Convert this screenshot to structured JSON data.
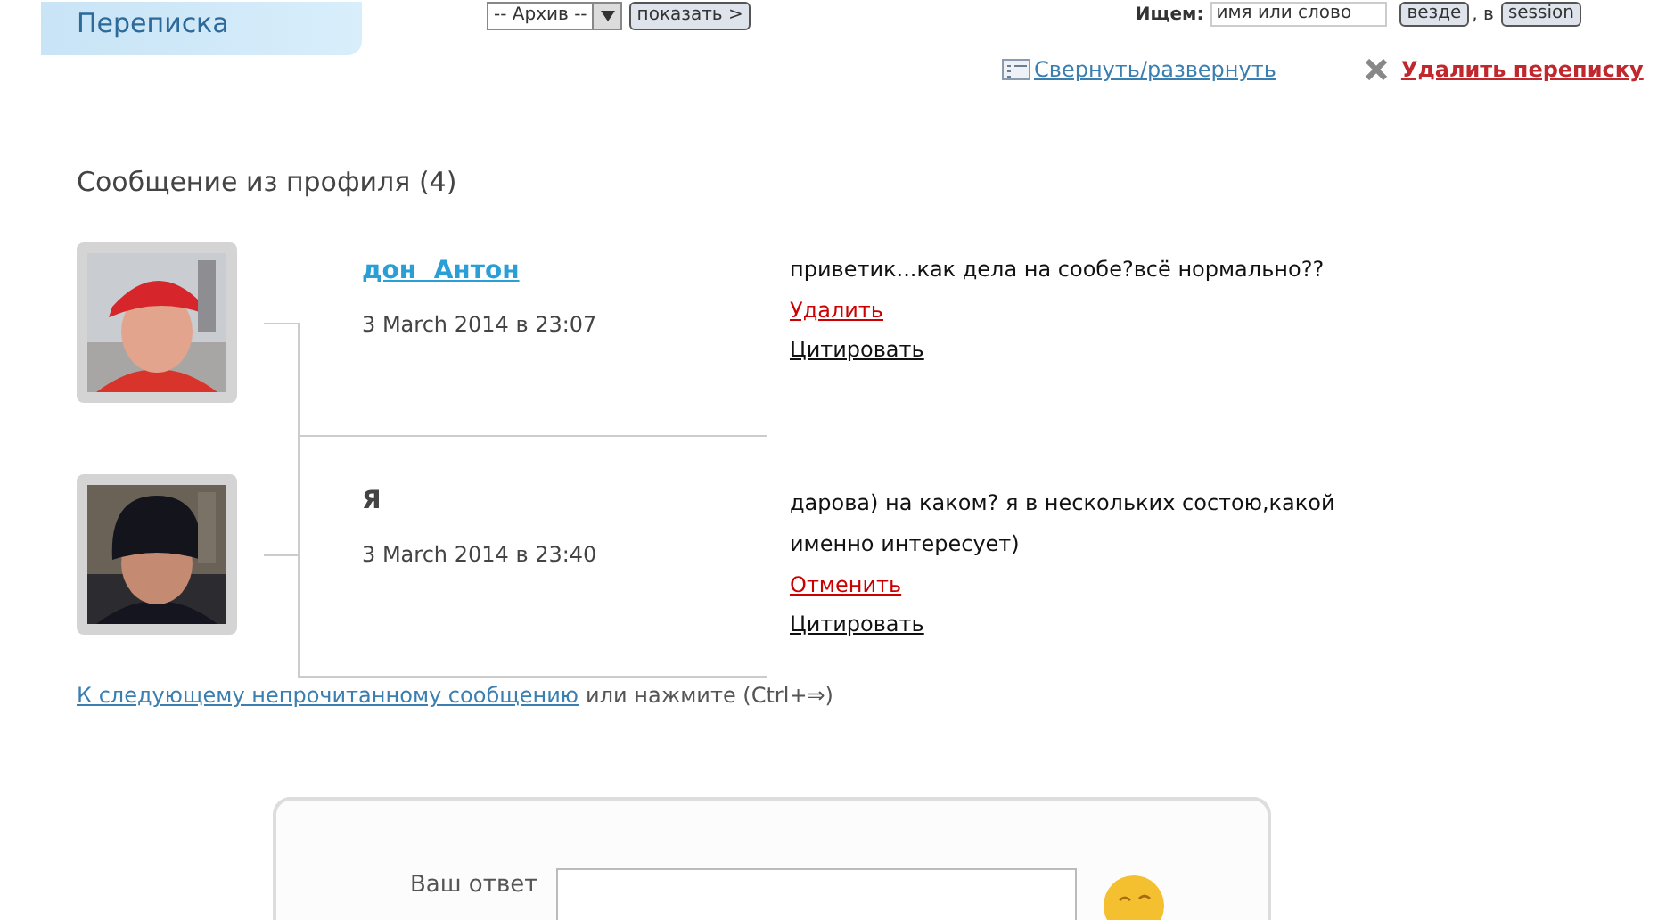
{
  "tab": {
    "label": "Переписка",
    "selected": true
  },
  "archive_select": {
    "value": "-- Архив --"
  },
  "show_button": "показать >",
  "search": {
    "label": "Ищем:",
    "value": "имя или слово",
    "scope_button": "везде",
    "separator": ", в",
    "in_button": "session"
  },
  "toolbar": {
    "toggle_link": "Свернуть/развернуть",
    "delete_link": "Удалить переписку"
  },
  "heading": "Сообщение из профиля (4)",
  "messages": [
    {
      "author": "дон  Антон",
      "author_is_link": true,
      "date": "3 March 2014 в 23:07",
      "text": "приветик...как дела на сообе?всё нормально??",
      "actions": [
        {
          "label": "Удалить",
          "kind": "danger"
        },
        {
          "label": "Цитировать",
          "kind": "plain"
        }
      ]
    },
    {
      "author": "Я",
      "author_is_link": false,
      "date": "3 March 2014 в 23:40",
      "text": "дарова) на каком? я в нескольких состою,какой именно интересует)",
      "actions": [
        {
          "label": "Отменить",
          "kind": "danger"
        },
        {
          "label": "Цитировать",
          "kind": "plain"
        }
      ]
    }
  ],
  "next_unread": {
    "link": "К следующему непрочитанному сообщению",
    "hint": "или нажмите (Ctrl+⇒)"
  },
  "reply": {
    "label": "Ваш ответ"
  }
}
